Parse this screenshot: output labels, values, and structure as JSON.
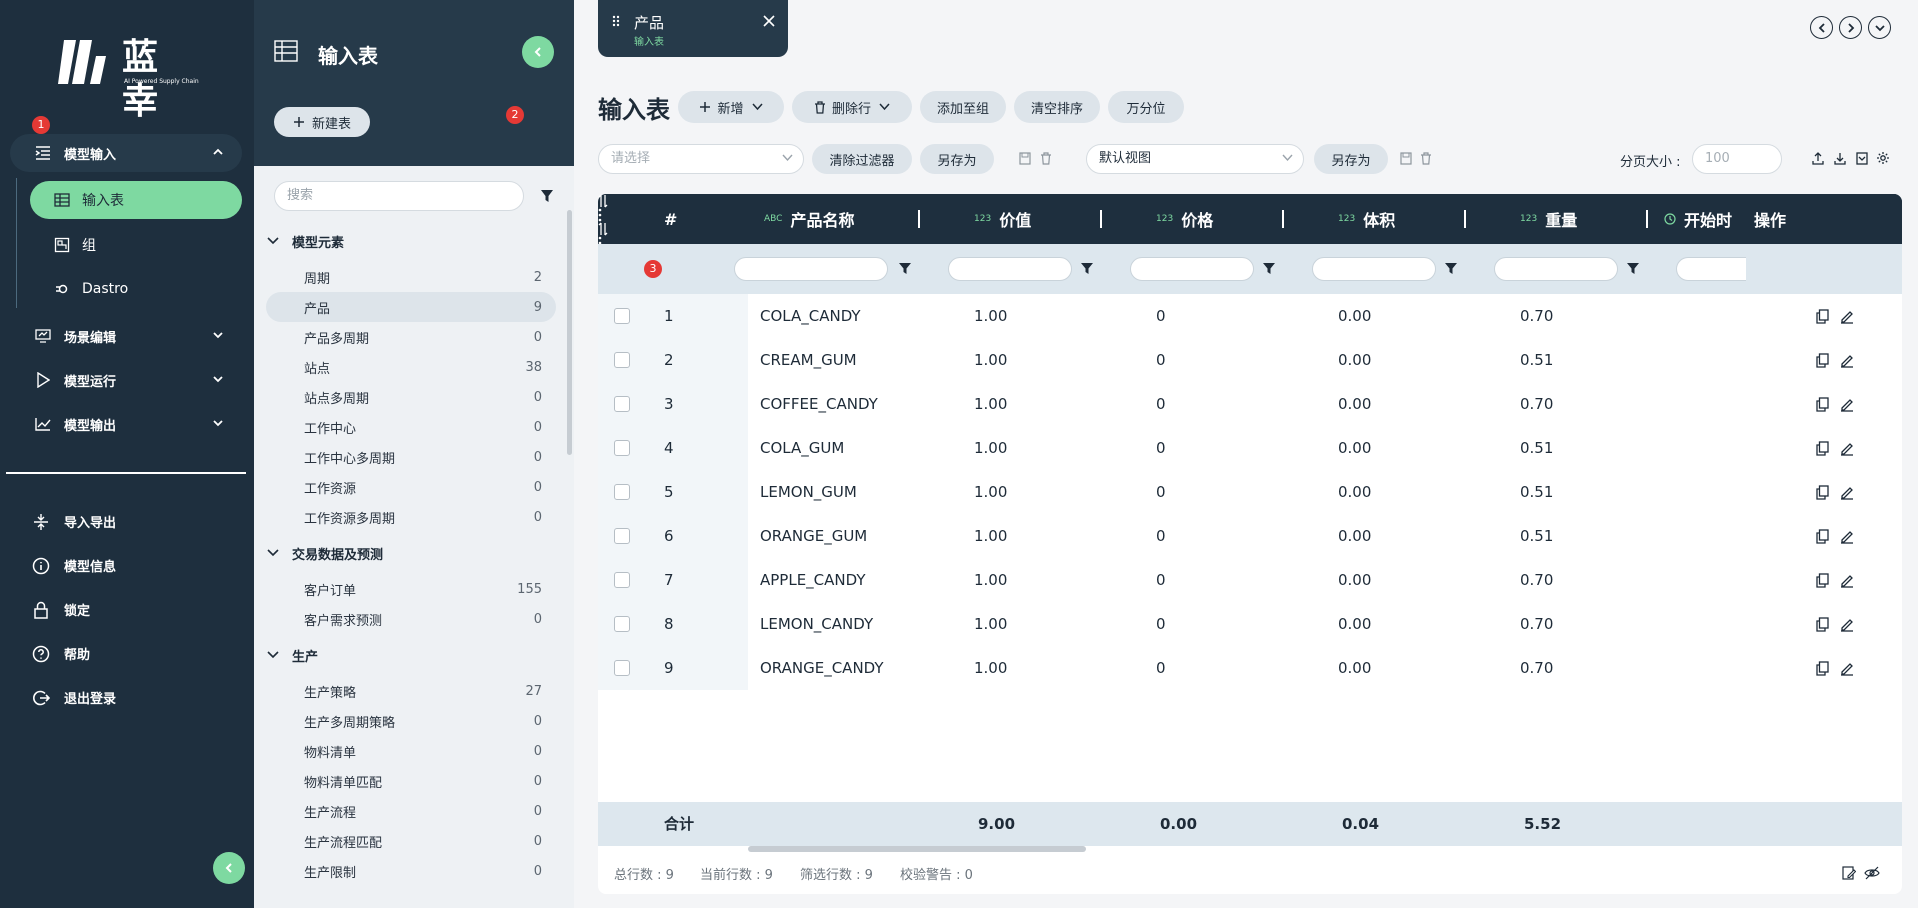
{
  "brand": {
    "name": "蓝幸",
    "tagline": "AI Powered Supply Chain"
  },
  "badges": {
    "b1": "1",
    "b2": "2",
    "b3": "3"
  },
  "nav": {
    "model_input": "模型输入",
    "sub_items": [
      "输入表",
      "组",
      "Dastro"
    ],
    "scene_edit": "场景编辑",
    "model_run": "模型运行",
    "model_output": "模型输出",
    "import_export": "导入导出",
    "model_info": "模型信息",
    "lock": "锁定",
    "help": "帮助",
    "logout": "退出登录"
  },
  "mid": {
    "title": "输入表",
    "new_table": "新建表",
    "search_placeholder": "搜索",
    "groups": [
      {
        "name": "模型元素",
        "items": [
          {
            "label": "周期",
            "count": "2"
          },
          {
            "label": "产品",
            "count": "9"
          },
          {
            "label": "产品多周期",
            "count": "0"
          },
          {
            "label": "站点",
            "count": "38"
          },
          {
            "label": "站点多周期",
            "count": "0"
          },
          {
            "label": "工作中心",
            "count": "0"
          },
          {
            "label": "工作中心多周期",
            "count": "0"
          },
          {
            "label": "工作资源",
            "count": "0"
          },
          {
            "label": "工作资源多周期",
            "count": "0"
          }
        ]
      },
      {
        "name": "交易数据及预测",
        "items": [
          {
            "label": "客户订单",
            "count": "155"
          },
          {
            "label": "客户需求预测",
            "count": "0"
          }
        ]
      },
      {
        "name": "生产",
        "items": [
          {
            "label": "生产策略",
            "count": "27"
          },
          {
            "label": "生产多周期策略",
            "count": "0"
          },
          {
            "label": "物料清单",
            "count": "0"
          },
          {
            "label": "物料清单匹配",
            "count": "0"
          },
          {
            "label": "生产流程",
            "count": "0"
          },
          {
            "label": "生产流程匹配",
            "count": "0"
          },
          {
            "label": "生产限制",
            "count": "0"
          }
        ]
      }
    ]
  },
  "tab": {
    "title": "产品",
    "subtitle": "输入表"
  },
  "page": {
    "title": "输入表",
    "btn_add": "新增",
    "btn_delete_rows": "删除行",
    "btn_add_to_group": "添加至组",
    "btn_clear_sort": "清空排序",
    "btn_thousands": "万分位",
    "filter_placeholder": "请选择",
    "btn_clear_filter": "清除过滤器",
    "btn_save_as": "另存为",
    "view_value": "默认视图",
    "btn_save_as2": "另存为",
    "page_size_label": "分页大小 :",
    "page_size_placeholder": "100"
  },
  "table": {
    "columns": {
      "index": "#",
      "name": "产品名称",
      "value": "价值",
      "price": "价格",
      "volume": "体积",
      "weight": "重量",
      "start": "开始时",
      "ops": "操作"
    },
    "type_tags": {
      "abc": "ABC",
      "num": "123"
    },
    "rows": [
      {
        "id": "1",
        "name": "COLA_CANDY",
        "value": "1.00",
        "price": "0",
        "volume": "0.00",
        "weight": "0.70"
      },
      {
        "id": "2",
        "name": "CREAM_GUM",
        "value": "1.00",
        "price": "0",
        "volume": "0.00",
        "weight": "0.51"
      },
      {
        "id": "3",
        "name": "COFFEE_CANDY",
        "value": "1.00",
        "price": "0",
        "volume": "0.00",
        "weight": "0.70"
      },
      {
        "id": "4",
        "name": "COLA_GUM",
        "value": "1.00",
        "price": "0",
        "volume": "0.00",
        "weight": "0.51"
      },
      {
        "id": "5",
        "name": "LEMON_GUM",
        "value": "1.00",
        "price": "0",
        "volume": "0.00",
        "weight": "0.51"
      },
      {
        "id": "6",
        "name": "ORANGE_GUM",
        "value": "1.00",
        "price": "0",
        "volume": "0.00",
        "weight": "0.51"
      },
      {
        "id": "7",
        "name": "APPLE_CANDY",
        "value": "1.00",
        "price": "0",
        "volume": "0.00",
        "weight": "0.70"
      },
      {
        "id": "8",
        "name": "LEMON_CANDY",
        "value": "1.00",
        "price": "0",
        "volume": "0.00",
        "weight": "0.70"
      },
      {
        "id": "9",
        "name": "ORANGE_CANDY",
        "value": "1.00",
        "price": "0",
        "volume": "0.00",
        "weight": "0.70"
      }
    ],
    "footer": {
      "label": "合计",
      "value": "9.00",
      "price": "0.00",
      "volume": "0.04",
      "weight": "5.52"
    }
  },
  "status": {
    "total_label": "总行数 :",
    "total": "9",
    "current_label": "当前行数 :",
    "current": "9",
    "filtered_label": "筛选行数 :",
    "filtered": "9",
    "warn_label": "校验警告 :",
    "warn": "0"
  },
  "colors": {
    "dark": "#1e2f3e",
    "accent": "#7ed9a1",
    "badge": "#e53935",
    "light": "#dde4ea"
  }
}
